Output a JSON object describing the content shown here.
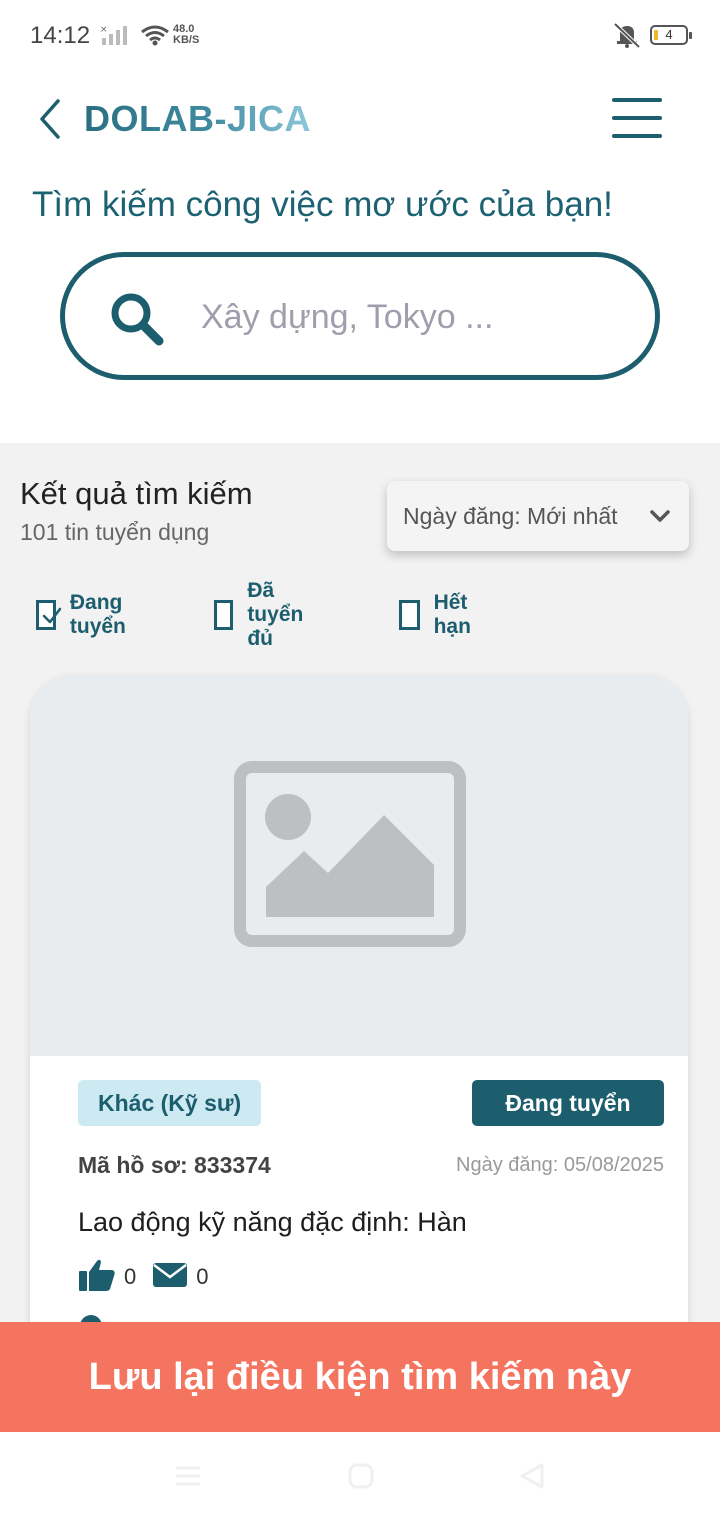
{
  "status_bar": {
    "time": "14:12",
    "speed_value": "48.0",
    "speed_unit": "KB/S",
    "battery": "4"
  },
  "header": {
    "app_title": "DOLAB-JICA"
  },
  "tagline": "Tìm kiếm công việc mơ ước của bạn!",
  "search": {
    "placeholder": "Xây dựng, Tokyo ..."
  },
  "results": {
    "title": "Kết quả tìm kiếm",
    "count": "101 tin tuyển dụng",
    "sort_label": "Ngày đăng: Mới nhất"
  },
  "filters": [
    {
      "label": "Đang tuyển",
      "checked": true
    },
    {
      "label": "Đã tuyển đủ",
      "checked": false
    },
    {
      "label": "Hết hạn",
      "checked": false
    }
  ],
  "card": {
    "category": "Khác (Kỹ sư)",
    "status": "Đang tuyển",
    "profile_id": "Mã hồ sơ: 833374",
    "post_date": "Ngày đăng: 05/08/2025",
    "title": "Lao động kỹ năng đặc định: Hàn",
    "likes": "0",
    "messages": "0"
  },
  "save_button_label": "Lưu lại điều kiện tìm kiếm này",
  "colors": {
    "primary": "#1c5e6e",
    "accent": "#f4745f",
    "badge_bg": "#cdeaf2"
  }
}
